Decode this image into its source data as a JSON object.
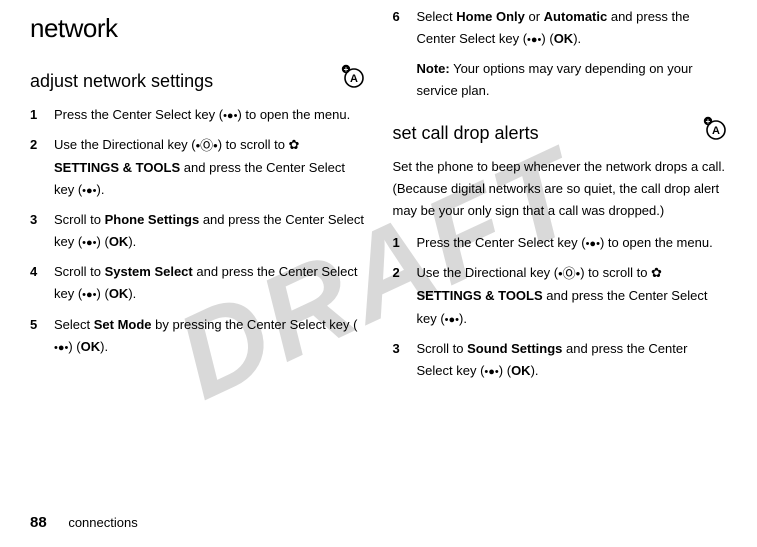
{
  "watermark": "DRAFT",
  "pageNumber": "88",
  "footerText": "connections",
  "left": {
    "h1": "network",
    "h2": "adjust network settings",
    "steps": [
      {
        "n": "1",
        "pre": "Press the Center Select key (",
        "post": ") to open the menu."
      },
      {
        "n": "2",
        "pre": "Use the Directional key (",
        "mid1": ") to scroll to ",
        "label": "SETTINGS & TOOLS",
        "mid2": " and press the Center Select key (",
        "post": ")."
      },
      {
        "n": "3",
        "pre": "Scroll to ",
        "bold": "Phone Settings",
        "mid": " and press the Center Select key (",
        "paren": ") (",
        "ok": "OK",
        "post": ")."
      },
      {
        "n": "4",
        "pre": "Scroll to ",
        "bold": "System Select",
        "mid": " and press the Center Select key (",
        "paren": ") (",
        "ok": "OK",
        "post": ")."
      },
      {
        "n": "5",
        "pre": "Select ",
        "bold": "Set Mode",
        "mid": " by pressing the Center Select key (",
        "paren": ") (",
        "ok": "OK",
        "post": ")."
      }
    ]
  },
  "right": {
    "step6": {
      "n": "6",
      "pre": "Select ",
      "bold1": "Home Only",
      "or": " or ",
      "bold2": "Automatic",
      "mid": " and press the Center Select key (",
      "paren": ") (",
      "ok": "OK",
      "post": ")."
    },
    "noteLabel": "Note:",
    "noteText": " Your options may vary depending on your service plan.",
    "h2": "set call drop alerts",
    "intro": "Set the phone to beep whenever the network drops a call. (Because digital networks are so quiet, the call drop alert may be your only sign that a call was dropped.)",
    "steps": [
      {
        "n": "1",
        "pre": "Press the Center Select key (",
        "post": ") to open the menu."
      },
      {
        "n": "2",
        "pre": "Use the Directional key (",
        "mid1": ") to scroll to ",
        "label": "SETTINGS & TOOLS",
        "mid2": " and press the Center Select key (",
        "post": ")."
      },
      {
        "n": "3",
        "pre": "Scroll to ",
        "bold": "Sound Settings",
        "mid": " and press the Center Select key (",
        "paren": ") (",
        "ok": "OK",
        "post": ")."
      }
    ]
  }
}
